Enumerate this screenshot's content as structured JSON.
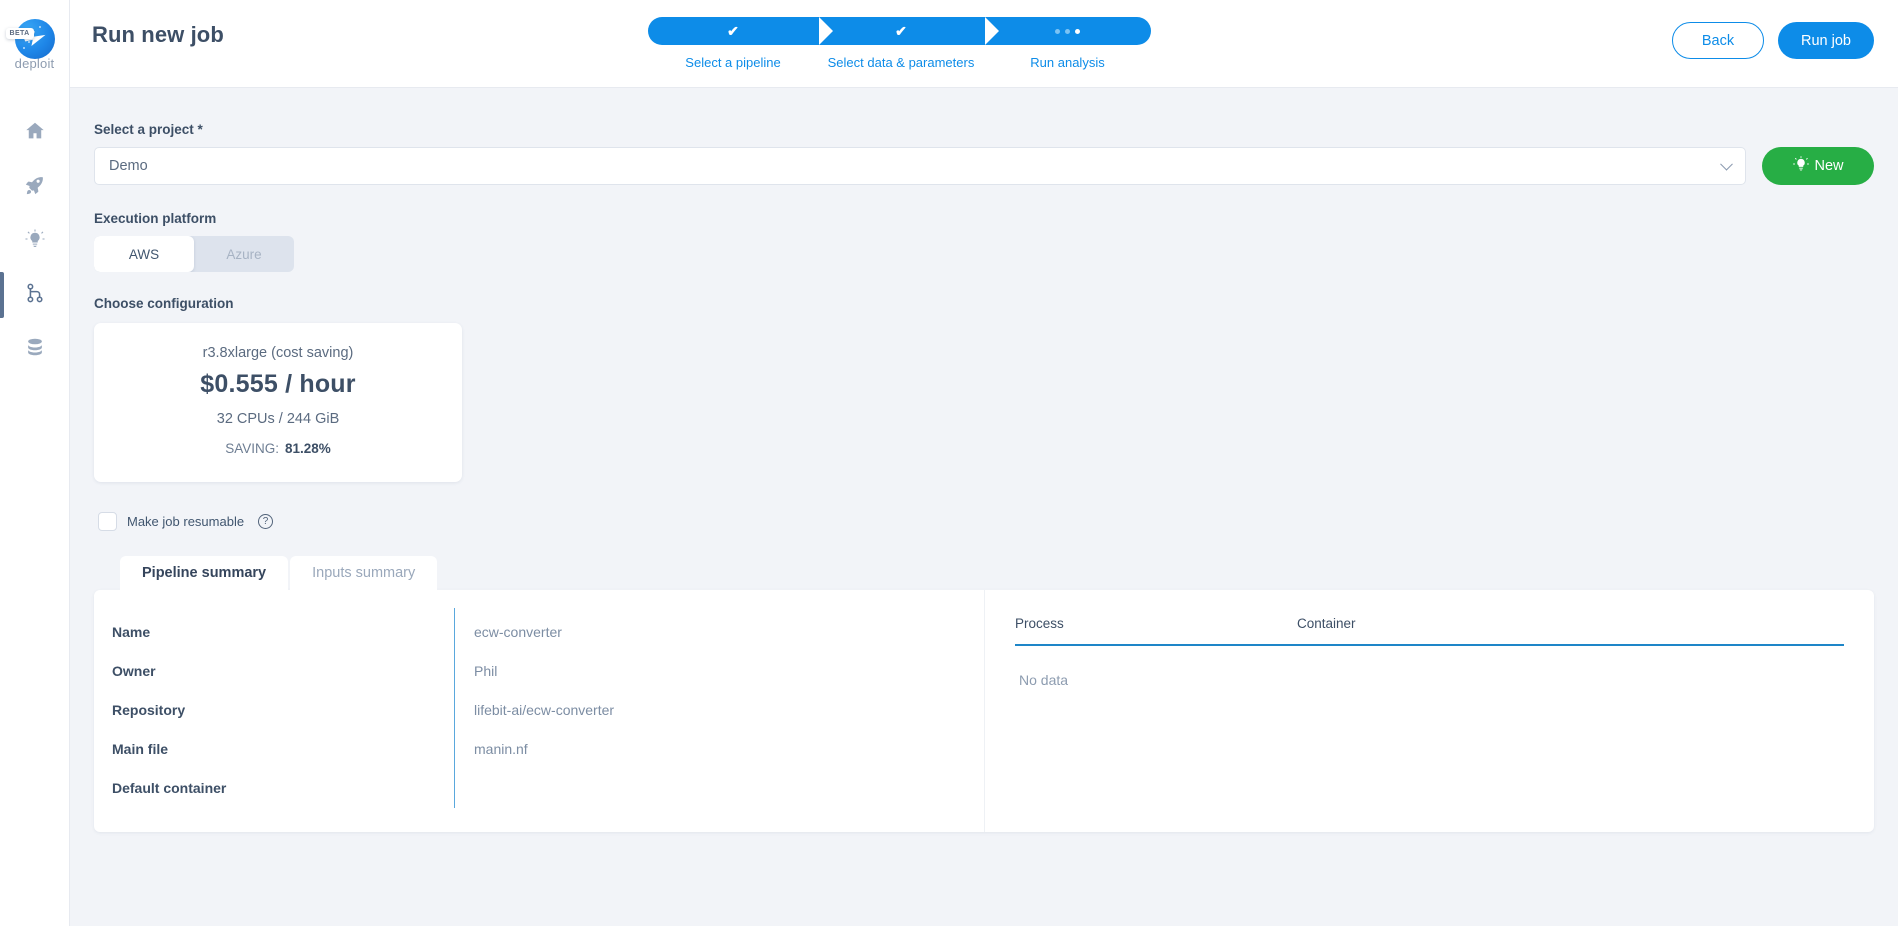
{
  "brand": {
    "name": "deploit",
    "badge": "BETA"
  },
  "sidebar": {
    "items": [
      {
        "name": "home",
        "icon": "home-icon",
        "active": false
      },
      {
        "name": "rocket",
        "icon": "rocket-icon",
        "active": false
      },
      {
        "name": "lightbulb",
        "icon": "lightbulb-icon",
        "active": false
      },
      {
        "name": "pipelines",
        "icon": "code-branch-icon",
        "active": true
      },
      {
        "name": "data",
        "icon": "database-icon",
        "active": false
      }
    ]
  },
  "header": {
    "title": "Run new job",
    "back_label": "Back",
    "run_label": "Run job",
    "steps": [
      {
        "label": "Select a pipeline",
        "state": "complete"
      },
      {
        "label": "Select data & parameters",
        "state": "complete"
      },
      {
        "label": "Run analysis",
        "state": "current"
      }
    ],
    "accent": "#0d8ce8"
  },
  "form": {
    "project_label": "Select a project *",
    "project_value": "Demo",
    "new_button_label": "New",
    "new_button_color": "#27ae45",
    "platform_label": "Execution platform",
    "platforms": [
      {
        "label": "AWS",
        "selected": true,
        "disabled": false
      },
      {
        "label": "Azure",
        "selected": false,
        "disabled": true
      }
    ],
    "config_label": "Choose configuration",
    "config": {
      "instance": "r3.8xlarge (cost saving)",
      "price": "$0.555 / hour",
      "specs": "32 CPUs / 244 GiB",
      "saving_label": "SAVING:",
      "saving_value": "81.28%"
    },
    "resumable_label": "Make job resumable",
    "resumable_checked": false,
    "help_glyph": "?"
  },
  "tabs": [
    {
      "label": "Pipeline summary",
      "active": true
    },
    {
      "label": "Inputs summary",
      "active": false
    }
  ],
  "pipeline_summary": {
    "rows": [
      {
        "key": "Name",
        "value": "ecw-converter"
      },
      {
        "key": "Owner",
        "value": "Phil"
      },
      {
        "key": "Repository",
        "value": "lifebit-ai/ecw-converter"
      },
      {
        "key": "Main file",
        "value": "manin.nf"
      },
      {
        "key": "Default container",
        "value": ""
      }
    ]
  },
  "process_table": {
    "columns": [
      "Process",
      "Container"
    ],
    "empty_text": "No data",
    "rows": []
  }
}
